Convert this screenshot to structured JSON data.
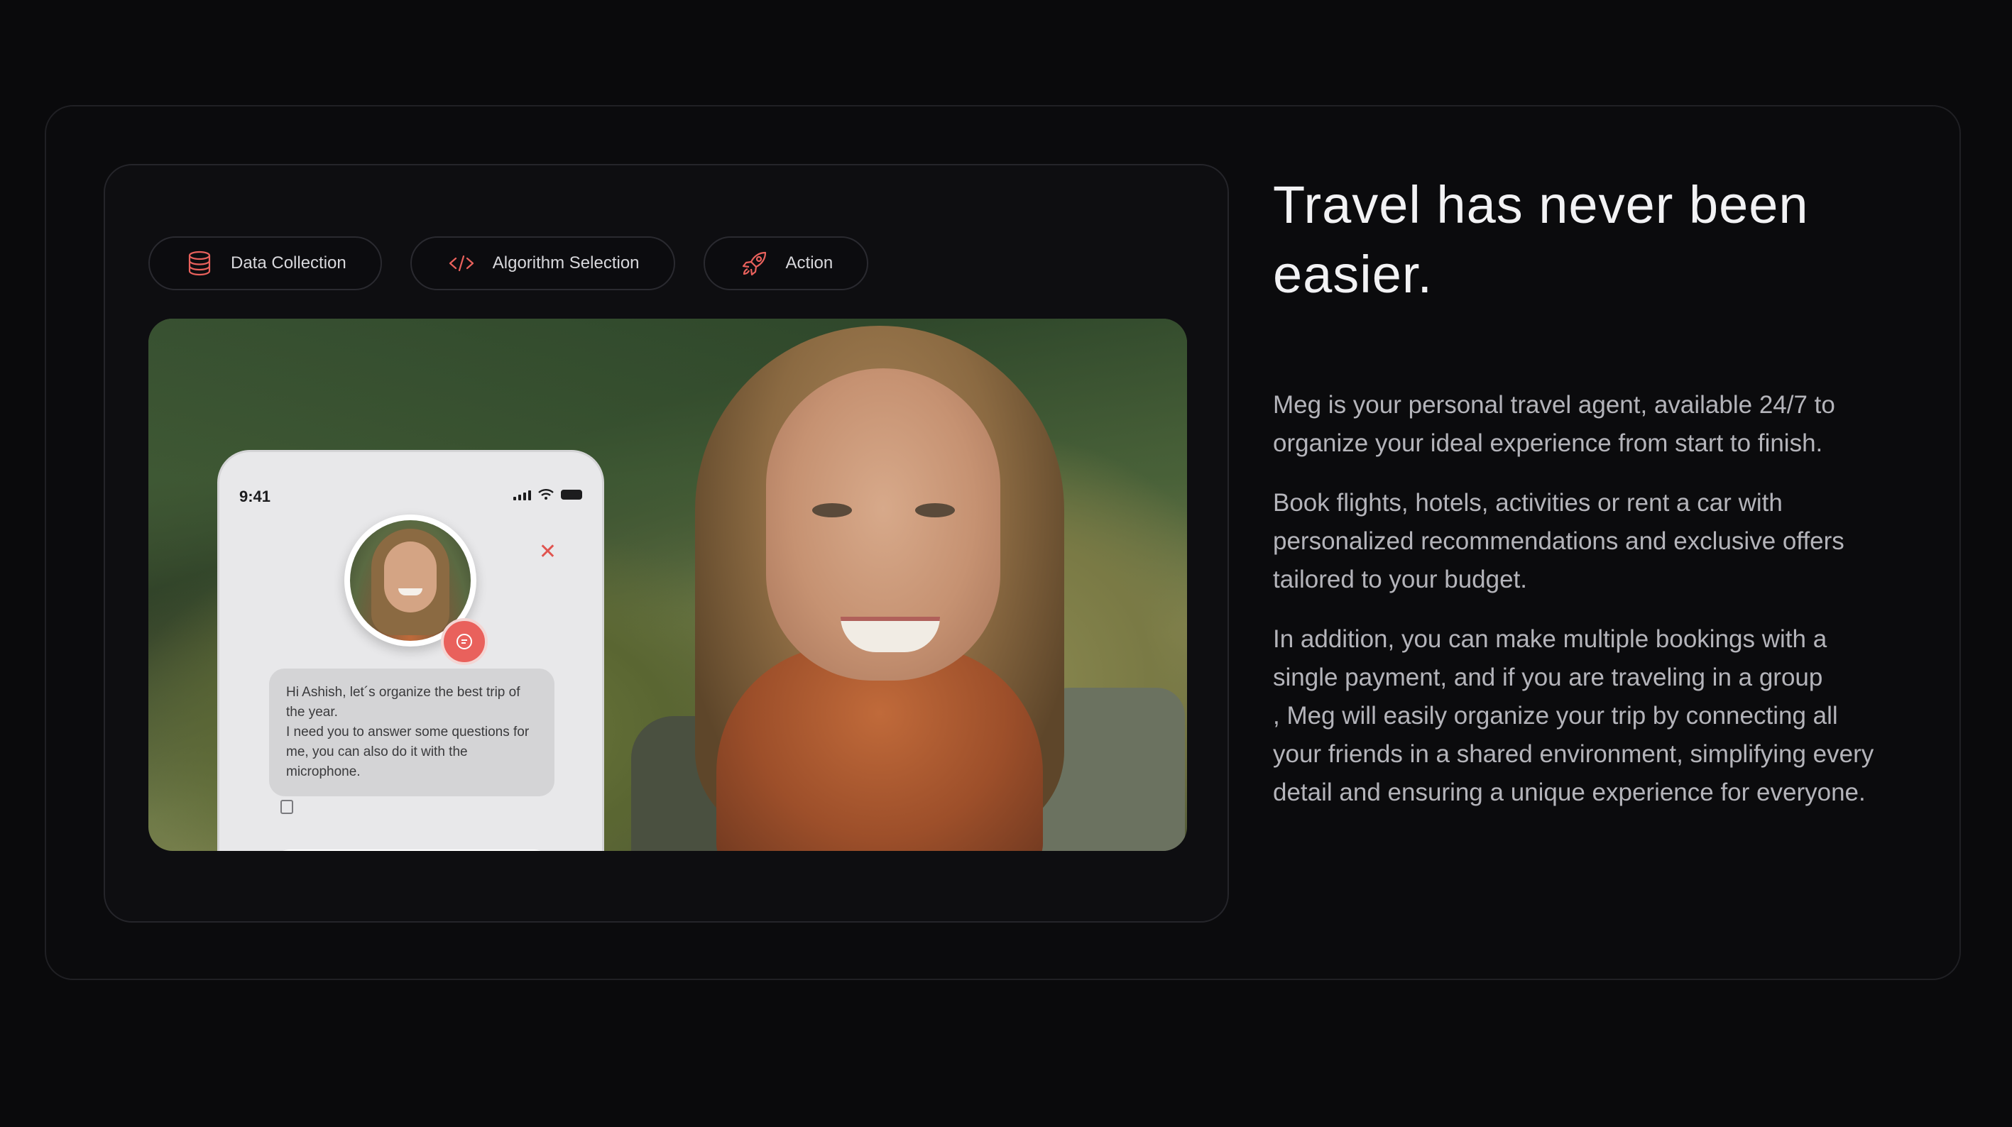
{
  "chips": [
    {
      "label": "Data Collection",
      "icon": "database-icon"
    },
    {
      "label": "Algorithm Selection",
      "icon": "code-icon"
    },
    {
      "label": "Action",
      "icon": "rocket-icon"
    }
  ],
  "phone": {
    "time": "9:41",
    "message": "Hi Ashish, let´s organize the best trip of the year.\nI need you to answer some questions for me, you can also do it with the microphone."
  },
  "headline": "Travel has never been easier.",
  "paragraphs": [
    "Meg is your personal travel agent, available 24/7 to organize your ideal experience from start to finish.",
    "Book flights, hotels, activities or rent a car with personalized recommendations and exclusive offers tailored to your budget.",
    "In addition, you can make multiple bookings with a single payment, and if you are traveling in a group\n, Meg will easily organize your trip by connecting all your friends in a shared environment, simplifying every detail and ensuring a unique experience for everyone."
  ],
  "colors": {
    "accent": "#e9615c",
    "background": "#0a0a0c",
    "text_muted": "#b4b4ba"
  }
}
